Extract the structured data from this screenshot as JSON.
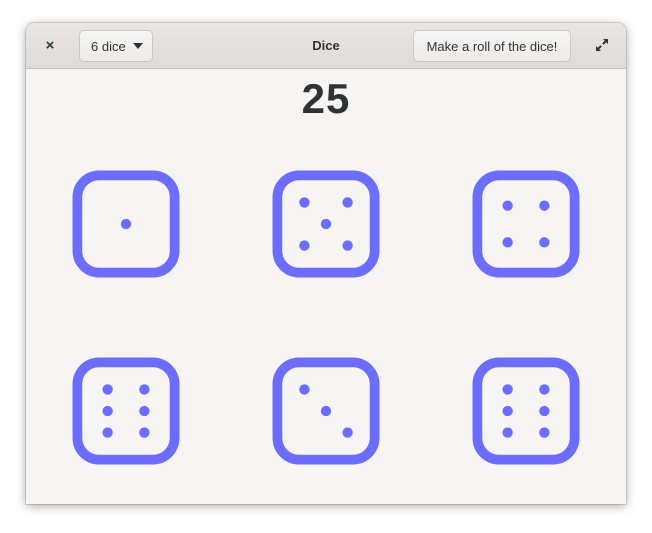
{
  "window": {
    "title": "Dice"
  },
  "header": {
    "close_icon": "×",
    "dice_count_label": "6 dice",
    "roll_button_label": "Make a roll of the dice!",
    "maximize_icon": "maximize-icon"
  },
  "result": {
    "total": "25"
  },
  "dice": {
    "color": "#6c6cff",
    "values": [
      1,
      5,
      4,
      6,
      3,
      6
    ]
  }
}
